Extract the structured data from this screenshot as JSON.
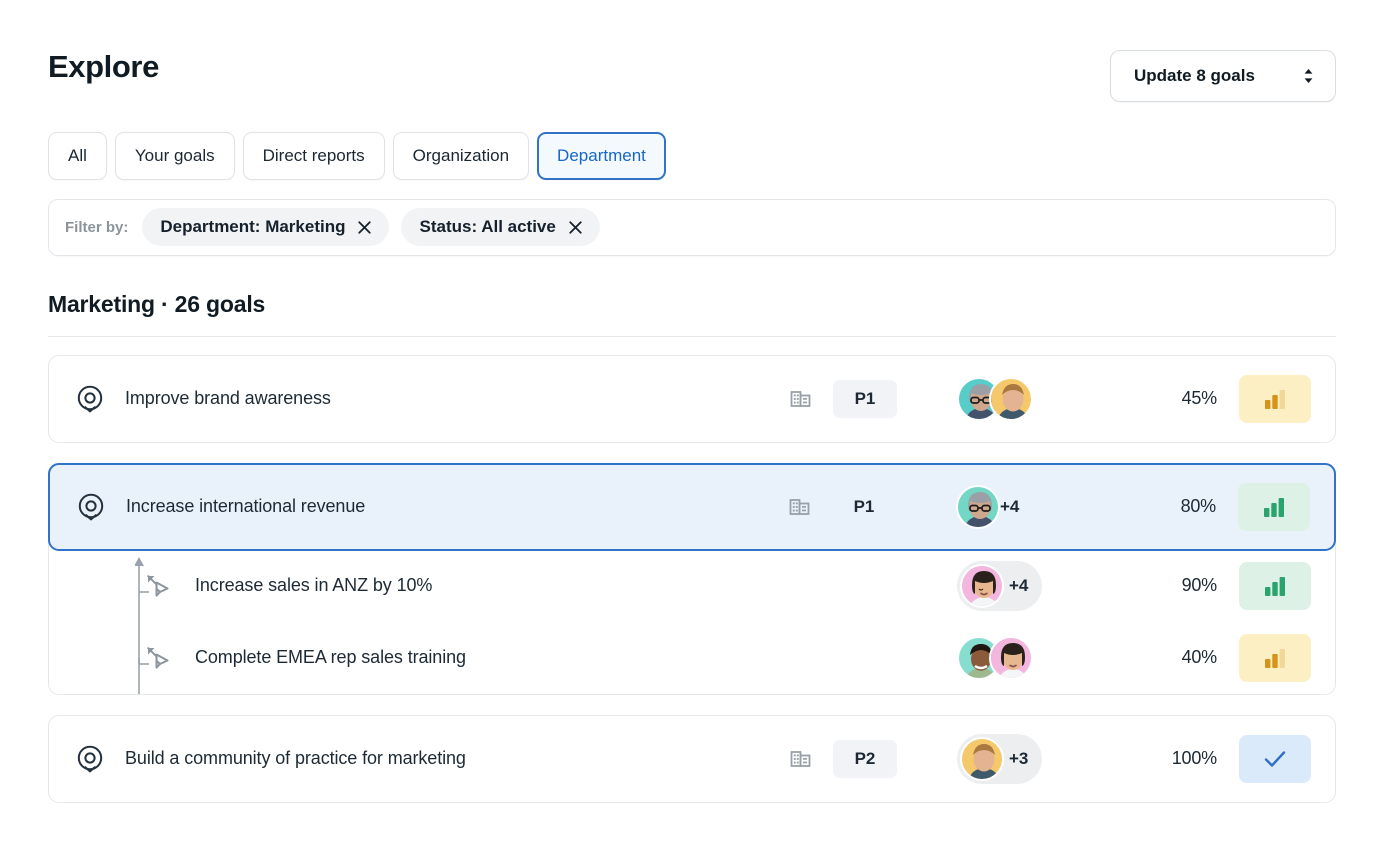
{
  "header": {
    "title": "Explore",
    "update_button": {
      "label": "Update 8 goals",
      "icon": "up-down-chevron-icon"
    }
  },
  "tabs": [
    {
      "label": "All",
      "active": false
    },
    {
      "label": "Your goals",
      "active": false
    },
    {
      "label": "Direct reports",
      "active": false
    },
    {
      "label": "Organization",
      "active": false
    },
    {
      "label": "Department",
      "active": true
    }
  ],
  "filters": {
    "label": "Filter by:",
    "chips": [
      {
        "label": "Department: Marketing",
        "remove_icon": "close-icon"
      },
      {
        "label": "Status: All active",
        "remove_icon": "close-icon"
      }
    ]
  },
  "section": {
    "heading": "Marketing · 26 goals"
  },
  "goals": [
    {
      "name": "Improve brand awareness",
      "icon": "goal-target-icon",
      "scope_icon": "building-icon",
      "priority": "P1",
      "avatars": [
        {
          "name": "avatar-woman-glasses",
          "bg": "#57ccc8"
        },
        {
          "name": "avatar-man-blond",
          "bg": "#f5c96b"
        }
      ],
      "more_count": "",
      "progress": "45%",
      "status": "amber",
      "status_icon": "bar-chart-icon",
      "selected": false,
      "subgoals": []
    },
    {
      "name": "Increase international revenue",
      "icon": "goal-target-icon",
      "scope_icon": "building-icon",
      "priority": "P1",
      "avatars": [
        {
          "name": "avatar-woman-gray-hair",
          "bg": "#74d6c4"
        }
      ],
      "more_count": "+4",
      "progress": "80%",
      "status": "green",
      "status_icon": "bar-chart-icon",
      "selected": true,
      "subgoals": [
        {
          "name": "Increase sales in ANZ by 10%",
          "icon": "contributing-goal-arrow-icon",
          "avatars": [
            {
              "name": "avatar-woman-dark-hair",
              "bg": "#f3b6de"
            }
          ],
          "more_count": "+4",
          "progress": "90%",
          "status": "green",
          "status_icon": "bar-chart-icon"
        },
        {
          "name": "Complete EMEA rep sales training",
          "icon": "contributing-goal-arrow-icon",
          "avatars": [
            {
              "name": "avatar-man-beard",
              "bg": "#86ddd0"
            },
            {
              "name": "avatar-woman-smiling",
              "bg": "#f3b6de"
            }
          ],
          "more_count": "",
          "progress": "40%",
          "status": "amber",
          "status_icon": "bar-chart-icon"
        }
      ]
    },
    {
      "name": "Build a community of practice for marketing",
      "icon": "goal-target-icon",
      "scope_icon": "building-icon",
      "priority": "P2",
      "avatars": [
        {
          "name": "avatar-man-blond",
          "bg": "#f5c96b"
        }
      ],
      "more_count": "+3",
      "progress": "100%",
      "status": "blue",
      "status_icon": "check-icon",
      "selected": false,
      "subgoals": []
    }
  ],
  "colors": {
    "accent_blue": "#3272c8",
    "selected_row_bg": "#e9f2fb",
    "status_amber_bg": "#fcefc3",
    "status_amber_fg": "#d69318",
    "status_green_bg": "#def1e6",
    "status_green_fg": "#2ba36e",
    "status_blue_bg": "#dbeafb",
    "status_blue_fg": "#2f6fc4",
    "text_primary": "#101b23",
    "text_muted": "#8b949d"
  }
}
